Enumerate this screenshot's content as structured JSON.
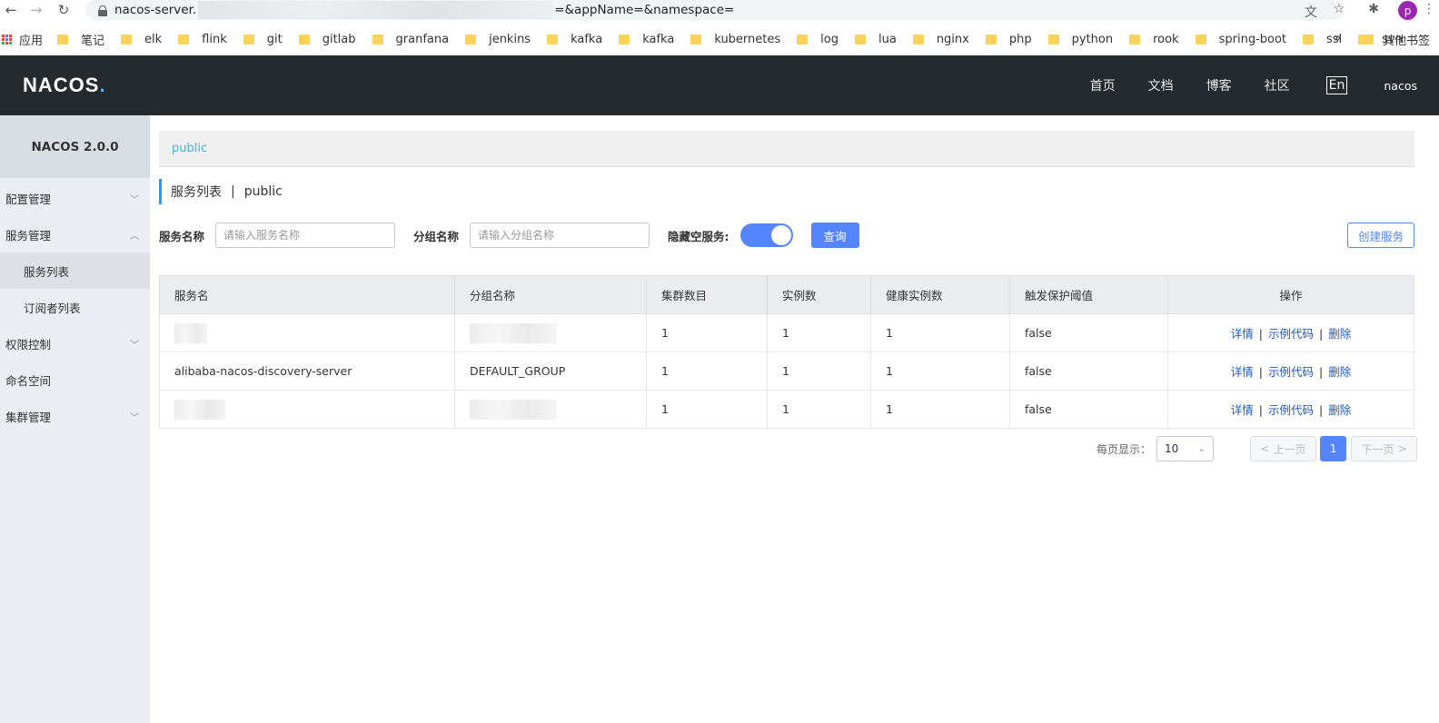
{
  "browser": {
    "url_prefix": "nacos-server.",
    "url_suffix": "=&appName=&namespace=",
    "profile_initial": "p",
    "bookmarks": {
      "apps": "应用",
      "items": [
        "笔记",
        "elk",
        "flink",
        "git",
        "gitlab",
        "granfana",
        "jenkins",
        "kafka",
        "kafka",
        "kubernetes",
        "log",
        "lua",
        "nginx",
        "php",
        "python",
        "rook",
        "spring-boot",
        "ssl",
        "svn"
      ],
      "more": "»",
      "other": "其他书签"
    }
  },
  "header": {
    "logo_main": "NACOS",
    "logo_dot": ".",
    "nav": [
      "首页",
      "文档",
      "博客",
      "社区"
    ],
    "lang": "En",
    "user": "nacos"
  },
  "sidebar": {
    "title": "NACOS 2.0.0",
    "items": {
      "config": "配置管理",
      "service": "服务管理",
      "service_list": "服务列表",
      "subscriber_list": "订阅者列表",
      "auth": "权限控制",
      "namespace": "命名空间",
      "cluster": "集群管理"
    }
  },
  "breadcrumb": "public",
  "page_title": {
    "main": "服务列表",
    "sep": "|",
    "namespace": "public"
  },
  "filters": {
    "service_label": "服务名称",
    "service_placeholder": "请输入服务名称",
    "group_label": "分组名称",
    "group_placeholder": "请输入分组名称",
    "hide_empty_label": "隐藏空服务:",
    "hide_empty": true,
    "query_button": "查询",
    "create_button": "创建服务"
  },
  "table": {
    "headers": [
      "服务名",
      "分组名称",
      "集群数目",
      "实例数",
      "健康实例数",
      "触发保护阈值",
      "操作"
    ],
    "rows": [
      {
        "name": "",
        "group": "",
        "clusters": "1",
        "instances": "1",
        "healthy": "1",
        "threshold": "false"
      },
      {
        "name": "alibaba-nacos-discovery-server",
        "group": "DEFAULT_GROUP",
        "clusters": "1",
        "instances": "1",
        "healthy": "1",
        "threshold": "false"
      },
      {
        "name": "",
        "group": "",
        "clusters": "1",
        "instances": "1",
        "healthy": "1",
        "threshold": "false"
      }
    ],
    "ops": {
      "detail": "详情",
      "sample": "示例代码",
      "delete": "删除",
      "sep": "|"
    }
  },
  "pagination": {
    "per_page_label": "每页显示：",
    "per_page": "10",
    "prev": "上一页",
    "current": "1",
    "next": "下一页"
  },
  "colors": {
    "primary": "#5584ff",
    "header_bg": "#252a2f",
    "sidebar_bg": "#eaedf1",
    "link": "#1f58cc"
  }
}
